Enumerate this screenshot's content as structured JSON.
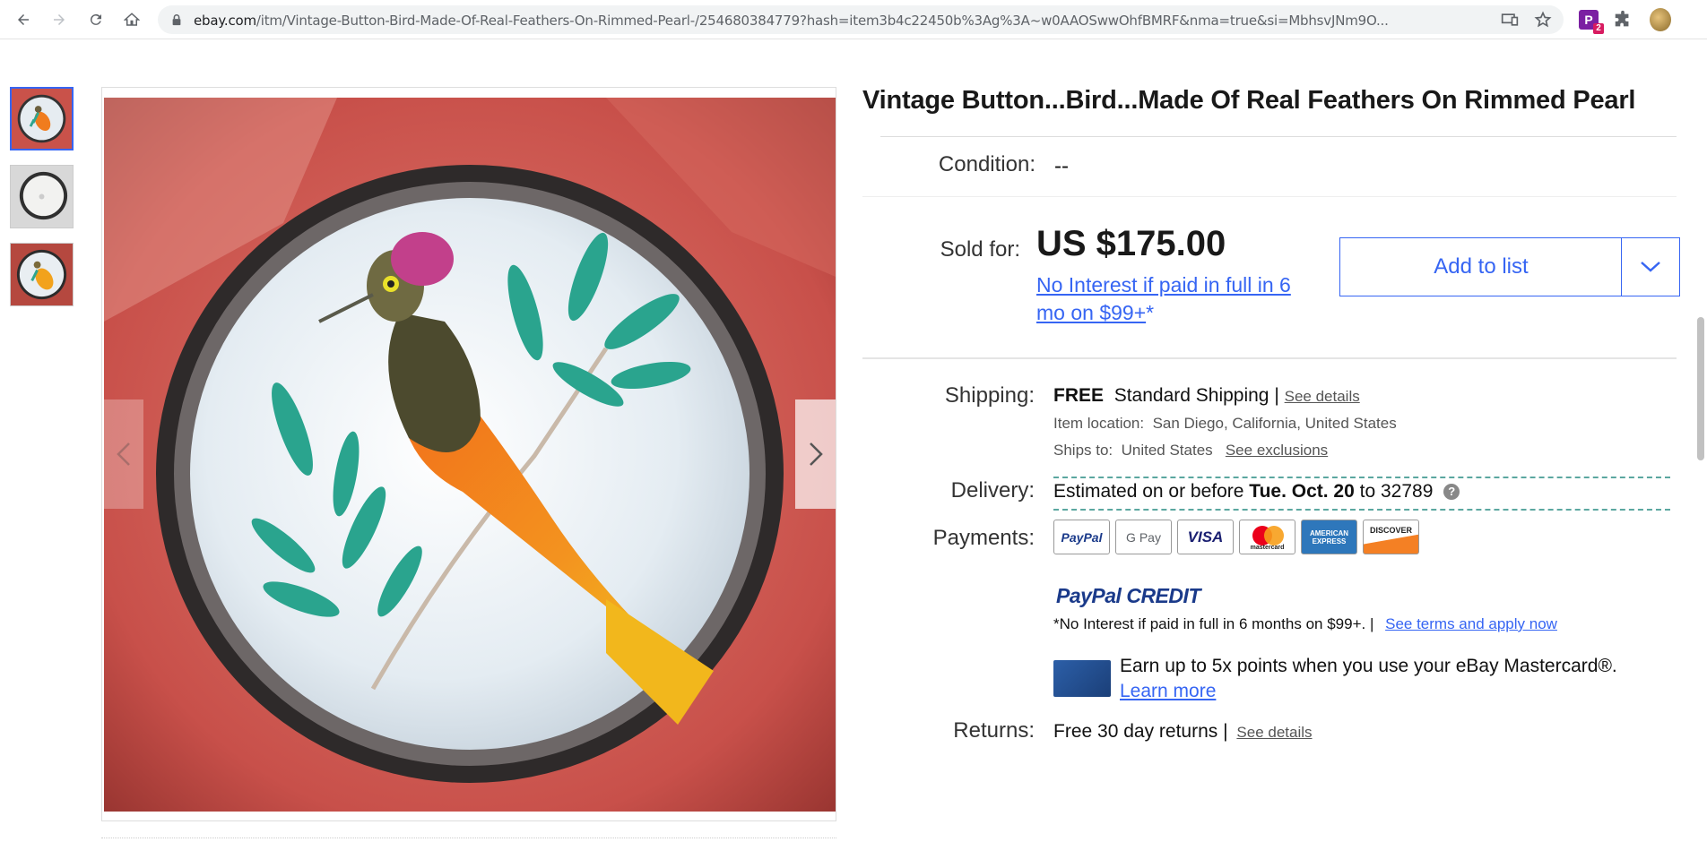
{
  "browser": {
    "url_host": "ebay.com",
    "url_path": "/itm/Vintage-Button-Bird-Made-Of-Real-Feathers-On-Rimmed-Pearl-/254680384779?hash=item3b4c22450b%3Ag%3A~w0AAOSwwOhfBMRF&nma=true&si=MbhsvJNm9O...",
    "extension_badge": "2"
  },
  "gallery": {
    "thumbnails": [
      "thumbnail-1",
      "thumbnail-2",
      "thumbnail-3"
    ]
  },
  "listing": {
    "title": "Vintage Button...Bird...Made Of Real Feathers On Rimmed Pearl",
    "condition_label": "Condition:",
    "condition_value": "--",
    "sold_label": "Sold for:",
    "price": "US $175.00",
    "promo_line1": "No Interest if paid in full in 6",
    "promo_line2": "mo on $99+",
    "promo_asterisk": "*",
    "add_to_list": "Add to list",
    "shipping_label": "Shipping:",
    "shipping_free": "FREE",
    "shipping_method": "Standard Shipping |",
    "shipping_details_link": "See details",
    "item_location_label": "Item location:",
    "item_location": "San Diego, California, United States",
    "ships_to_label": "Ships to:",
    "ships_to": "United States",
    "see_exclusions": "See exclusions",
    "delivery_label": "Delivery:",
    "delivery_prefix": "Estimated on or before",
    "delivery_date": "Tue. Oct. 20",
    "delivery_to": "to 32789",
    "delivery_help": "?",
    "payments_label": "Payments:",
    "payment_methods": [
      "PayPal",
      "G Pay",
      "VISA",
      "mastercard",
      "AMERICAN EXPRESS",
      "DISCOVER"
    ],
    "paypal_credit": "PayPal CREDIT",
    "credit_terms": "*No Interest if paid in full in 6 months on $99+.  |",
    "credit_terms_link": "See terms and apply now",
    "mastercard_offer": "Earn up to 5x points when you use your eBay Mastercard®.",
    "learn_more": "Learn more",
    "returns_label": "Returns:",
    "returns_value": "Free 30 day returns |",
    "returns_link": "See details"
  },
  "colors": {
    "accent": "#3665f3",
    "delivery_dash": "#5ba7a0"
  }
}
